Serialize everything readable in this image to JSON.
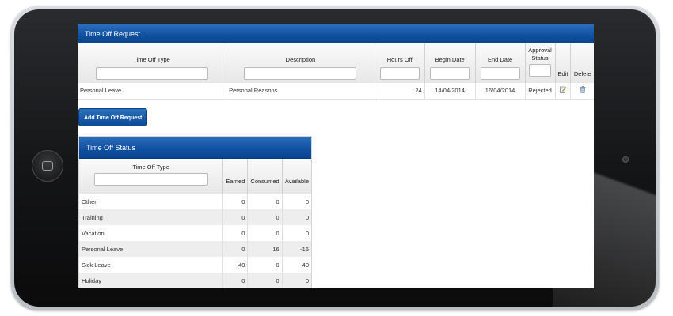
{
  "request_panel": {
    "title": "Time Off Request",
    "columns": {
      "type": "Time Off Type",
      "description": "Description",
      "hours": "Hours Off",
      "begin": "Begin Date",
      "end": "End Date",
      "approval": "Approval Status",
      "edit": "Edit",
      "delete": "Delete"
    },
    "rows": [
      {
        "type": "Personal Leave",
        "description": "Personal Reasons",
        "hours": "24",
        "begin": "14/04/2014",
        "end": "16/04/2014",
        "status": "Rejected"
      }
    ],
    "icons": {
      "edit": "edit-icon",
      "delete": "trash-icon"
    }
  },
  "add_button": {
    "label": "Add Time Off Request"
  },
  "status_panel": {
    "title": "Time Off Status",
    "columns": {
      "type": "Time Off Type",
      "earned": "Earned",
      "consumed": "Consumed",
      "available": "Available"
    },
    "rows": [
      {
        "type": "Other",
        "earned": "0",
        "consumed": "0",
        "available": "0"
      },
      {
        "type": "Training",
        "earned": "0",
        "consumed": "0",
        "available": "0"
      },
      {
        "type": "Vacation",
        "earned": "0",
        "consumed": "0",
        "available": "0"
      },
      {
        "type": "Personal Leave",
        "earned": "0",
        "consumed": "16",
        "available": "-16"
      },
      {
        "type": "Sick Leave",
        "earned": "40",
        "consumed": "0",
        "available": "40"
      },
      {
        "type": "Holiday",
        "earned": "0",
        "consumed": "0",
        "available": "0"
      }
    ]
  },
  "colors": {
    "header_blue": "#0f4f9f",
    "alt_row": "#eeeeee"
  }
}
